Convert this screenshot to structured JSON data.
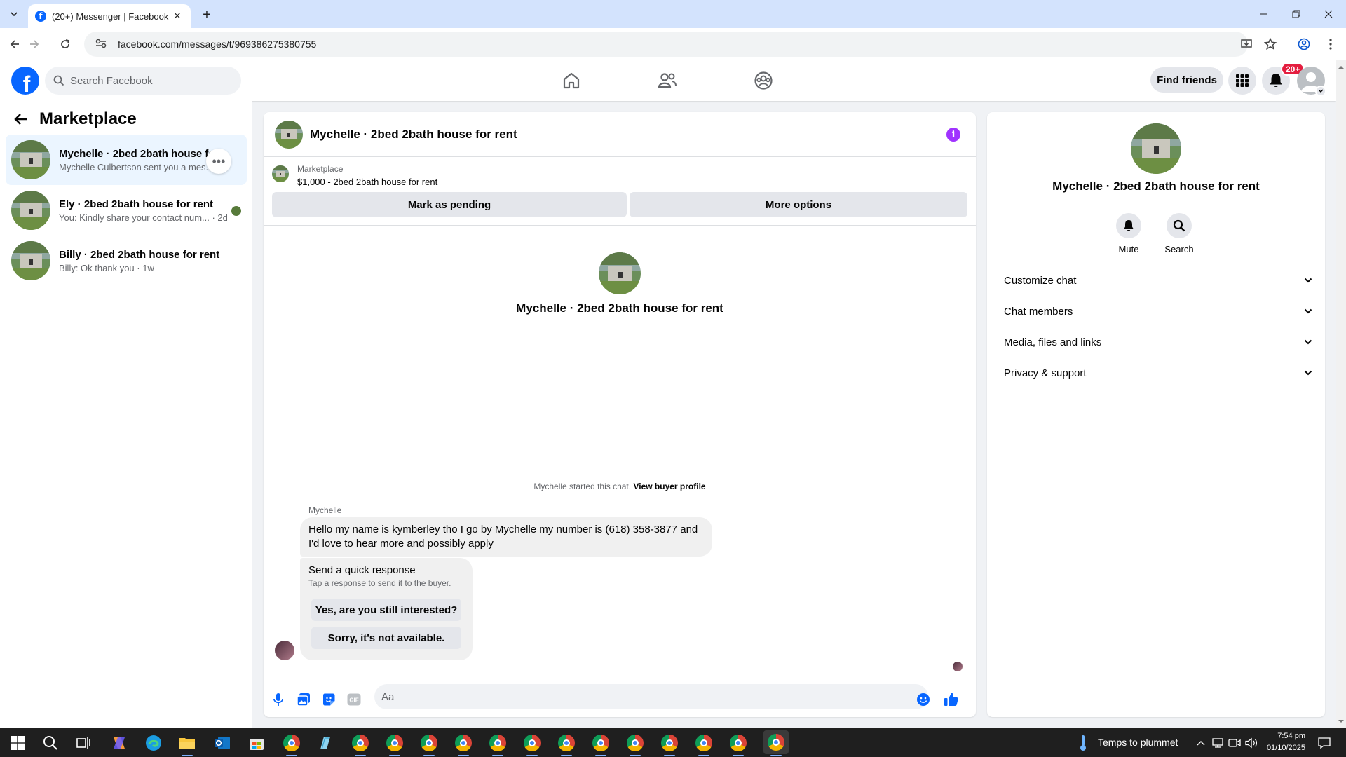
{
  "browser": {
    "tab_title": "(20+) Messenger | Facebook",
    "url": "facebook.com/messages/t/969386275380755"
  },
  "header": {
    "search_placeholder": "Search Facebook",
    "find_friends": "Find friends",
    "notification_badge": "20+"
  },
  "sidebar": {
    "title": "Marketplace",
    "conversations": [
      {
        "name": "Mychelle · 2bed 2bath house for rent",
        "preview": "Mychelle Culbertson sent you a mes... ·h",
        "active": true
      },
      {
        "name": "Ely · 2bed 2bath house for rent",
        "preview": "You: Kindly share your contact num... · 2d",
        "active": false
      },
      {
        "name": "Billy · 2bed 2bath house for rent",
        "preview": "Billy: Ok thank you · 1w",
        "active": false
      }
    ]
  },
  "chat": {
    "title": "Mychelle · 2bed 2bath house for rent",
    "listing_label": "Marketplace",
    "listing_price": "$1,000 - 2bed 2bath house for rent",
    "mark_pending": "Mark as pending",
    "more_options": "More options",
    "center_title": "Mychelle · 2bed 2bath house for rent",
    "started_text": "Mychelle started this chat.",
    "view_buyer": "View buyer profile",
    "sender": "Mychelle",
    "message": "Hello my name is kymberley tho I go by Mychelle my number is (618) 358-3877 and I'd love to hear more and possibly apply",
    "quick_response_title": "Send a quick response",
    "quick_response_sub": "Tap a response to send it to the buyer.",
    "quick_reply_1": "Yes, are you still interested?",
    "quick_reply_2": "Sorry, it's not available.",
    "composer_placeholder": "Aa"
  },
  "info_panel": {
    "title": "Mychelle · 2bed 2bath house for rent",
    "mute": "Mute",
    "search": "Search",
    "sections": [
      "Customize chat",
      "Chat members",
      "Media, files and links",
      "Privacy & support"
    ]
  },
  "taskbar": {
    "weather": "Temps to plummet",
    "time": "7:54 pm",
    "date": "01/10/2025"
  },
  "colors": {
    "fb_blue": "#0866ff",
    "badge_red": "#e41e3f",
    "info_purple": "#a033ff",
    "active_convo": "#ebf5ff"
  }
}
